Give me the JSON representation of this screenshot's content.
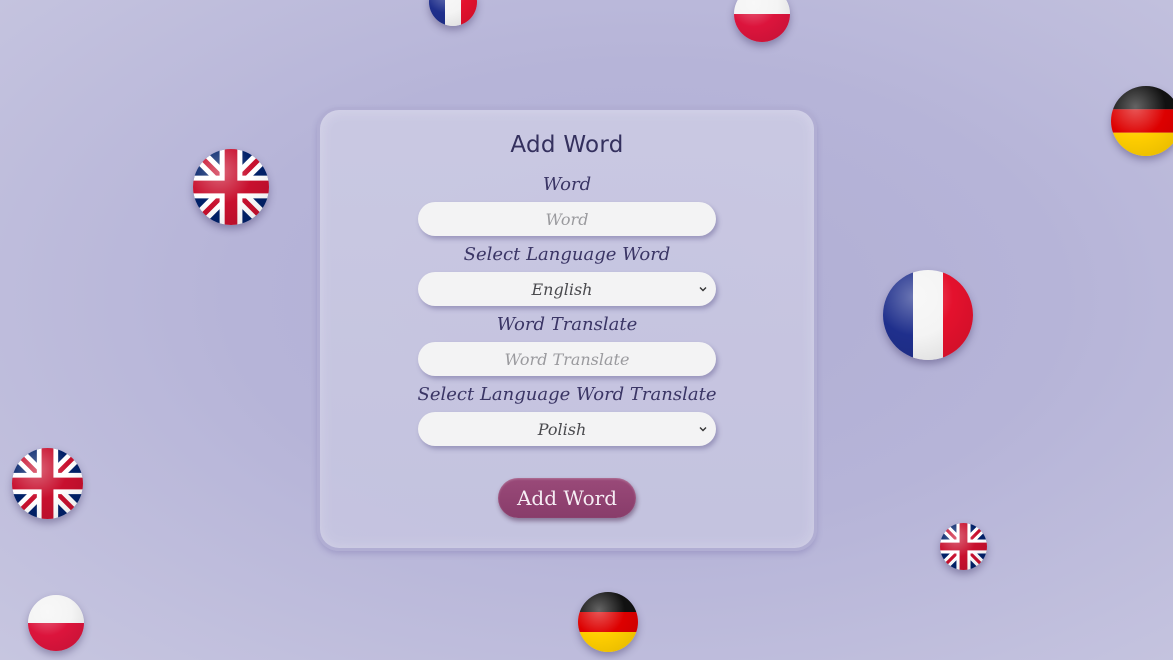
{
  "form": {
    "title": "Add Word",
    "word_label": "Word",
    "word_placeholder": "Word",
    "word_value": "",
    "lang_label": "Select Language Word",
    "lang_selected": "English",
    "translate_label": "Word Translate",
    "translate_placeholder": "Word Translate",
    "translate_value": "",
    "translate_lang_label": "Select Language Word Translate",
    "translate_lang_selected": "Polish",
    "submit_label": "Add Word"
  },
  "flags": [
    "flag-france-icon",
    "flag-poland-icon",
    "flag-germany-icon",
    "flag-uk-icon",
    "flag-france-icon",
    "flag-uk-icon",
    "flag-uk-icon",
    "flag-poland-icon",
    "flag-germany-icon"
  ],
  "colors": {
    "background": "#b3b1d6",
    "card": "#cccbe3",
    "button": "#8e4170",
    "text": "#34305e"
  }
}
